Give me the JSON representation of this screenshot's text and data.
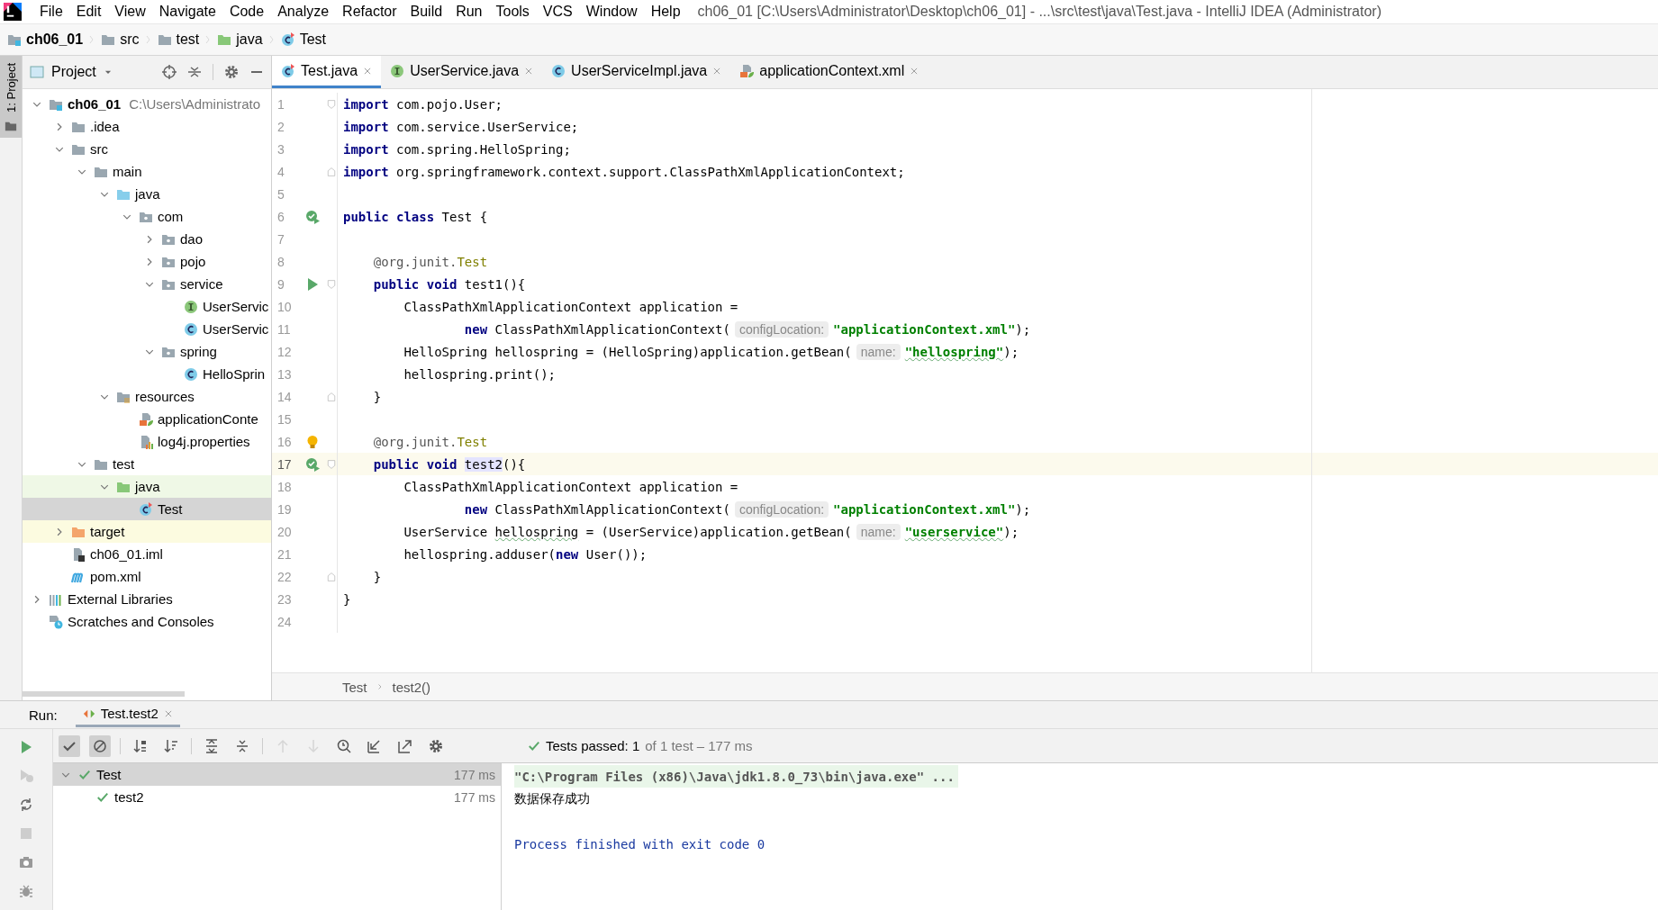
{
  "window": {
    "title": "ch06_01 [C:\\Users\\Administrator\\Desktop\\ch06_01] - ...\\src\\test\\java\\Test.java - IntelliJ IDEA (Administrator)"
  },
  "menu": [
    "File",
    "Edit",
    "View",
    "Navigate",
    "Code",
    "Analyze",
    "Refactor",
    "Build",
    "Run",
    "Tools",
    "VCS",
    "Window",
    "Help"
  ],
  "navigation_bar": [
    {
      "label": "ch06_01",
      "kind": "module"
    },
    {
      "label": "src",
      "kind": "folder"
    },
    {
      "label": "test",
      "kind": "folder"
    },
    {
      "label": "java",
      "kind": "test-root"
    },
    {
      "label": "Test",
      "kind": "test-class"
    }
  ],
  "left_tool_strip": {
    "label": "1: Project"
  },
  "project_panel": {
    "title": "Project",
    "tree": [
      {
        "label": "ch06_01",
        "path": "C:\\Users\\Administrato",
        "kind": "module",
        "expanded": true,
        "selected": false,
        "children": [
          {
            "label": ".idea",
            "kind": "folder",
            "expanded": false,
            "selected": false
          },
          {
            "label": "src",
            "kind": "folder",
            "expanded": true,
            "selected": false,
            "children": [
              {
                "label": "main",
                "kind": "folder",
                "expanded": true,
                "selected": false,
                "children": [
                  {
                    "label": "java",
                    "kind": "source-root",
                    "expanded": true,
                    "selected": false,
                    "children": [
                      {
                        "label": "com",
                        "kind": "package",
                        "expanded": true,
                        "selected": false,
                        "children": [
                          {
                            "label": "dao",
                            "kind": "package",
                            "expanded": false,
                            "selected": false
                          },
                          {
                            "label": "pojo",
                            "kind": "package",
                            "expanded": false,
                            "selected": false
                          },
                          {
                            "label": "service",
                            "kind": "package",
                            "expanded": true,
                            "selected": false,
                            "children": [
                              {
                                "label": "UserServic",
                                "kind": "interface",
                                "selected": false
                              },
                              {
                                "label": "UserServic",
                                "kind": "class",
                                "selected": false
                              }
                            ]
                          },
                          {
                            "label": "spring",
                            "kind": "package",
                            "expanded": true,
                            "selected": false,
                            "children": [
                              {
                                "label": "HelloSprin",
                                "kind": "class",
                                "selected": false
                              }
                            ]
                          }
                        ]
                      }
                    ]
                  },
                  {
                    "label": "resources",
                    "kind": "resources-root",
                    "expanded": true,
                    "selected": false,
                    "children": [
                      {
                        "label": "applicationConte",
                        "kind": "xml",
                        "selected": false
                      },
                      {
                        "label": "log4j.properties",
                        "kind": "properties",
                        "selected": false
                      }
                    ]
                  }
                ]
              },
              {
                "label": "test",
                "kind": "folder",
                "expanded": true,
                "selected": false,
                "children": [
                  {
                    "label": "java",
                    "kind": "test-root",
                    "expanded": true,
                    "selected": false,
                    "children": [
                      {
                        "label": "Test",
                        "kind": "test-class",
                        "selected": true
                      }
                    ]
                  }
                ]
              }
            ]
          },
          {
            "label": "target",
            "kind": "excluded",
            "expanded": false,
            "selected": false
          },
          {
            "label": "ch06_01.iml",
            "kind": "iml",
            "selected": false
          },
          {
            "label": "pom.xml",
            "kind": "maven",
            "selected": false
          }
        ]
      },
      {
        "label": "External Libraries",
        "kind": "libraries",
        "expanded": false,
        "selected": false
      },
      {
        "label": "Scratches and Consoles",
        "kind": "scratches",
        "selected": false
      }
    ]
  },
  "editor": {
    "tabs": [
      {
        "label": "Test.java",
        "kind": "test-class",
        "selected": true
      },
      {
        "label": "UserService.java",
        "kind": "interface",
        "selected": false
      },
      {
        "label": "UserServiceImpl.java",
        "kind": "class",
        "selected": false
      },
      {
        "label": "applicationContext.xml",
        "kind": "xml",
        "selected": false
      }
    ],
    "lines": [
      {
        "number": "1",
        "fold": {
          "kind": "start"
        },
        "current": false,
        "tokens": [
          {
            "kind": "keyword",
            "text": "import"
          },
          {
            "kind": "plain",
            "text": " com.pojo.User;"
          }
        ]
      },
      {
        "number": "2",
        "current": false,
        "tokens": [
          {
            "kind": "keyword",
            "text": "import"
          },
          {
            "kind": "plain",
            "text": " com.service.UserService;"
          }
        ]
      },
      {
        "number": "3",
        "current": false,
        "tokens": [
          {
            "kind": "keyword",
            "text": "import"
          },
          {
            "kind": "plain",
            "text": " com.spring.HelloSpring;"
          }
        ]
      },
      {
        "number": "4",
        "fold": {
          "kind": "end"
        },
        "current": false,
        "tokens": [
          {
            "kind": "keyword",
            "text": "import"
          },
          {
            "kind": "plain",
            "text": " org.springframework.context.support.ClassPathXmlApplicationContext;"
          }
        ]
      },
      {
        "number": "5",
        "current": false
      },
      {
        "number": "6",
        "marker": {
          "kind": "rerun"
        },
        "current": false,
        "tokens": [
          {
            "kind": "keyword",
            "text": "public class"
          },
          {
            "kind": "plain",
            "text": " Test {"
          }
        ]
      },
      {
        "number": "7",
        "current": false
      },
      {
        "number": "8",
        "current": false,
        "tokens": [
          {
            "kind": "annotation",
            "text": "    @org.junit."
          },
          {
            "kind": "annotation-name",
            "text": "Test"
          }
        ]
      },
      {
        "number": "9",
        "marker": {
          "kind": "run"
        },
        "fold": {
          "kind": "start"
        },
        "current": false,
        "tokens": [
          {
            "kind": "keyword",
            "text": "    public void"
          },
          {
            "kind": "plain",
            "text": " test1(){"
          }
        ]
      },
      {
        "number": "10",
        "current": false,
        "tokens": [
          {
            "kind": "plain",
            "text": "        ClassPathXmlApplicationContext application ="
          }
        ]
      },
      {
        "number": "11",
        "current": false,
        "tokens": [
          {
            "kind": "keyword",
            "text": "                new"
          },
          {
            "kind": "plain",
            "text": " ClassPathXmlApplicationContext("
          },
          {
            "kind": "hint",
            "text": "configLocation:"
          },
          {
            "kind": "string",
            "text": "\"applicationContext.xml\""
          },
          {
            "kind": "plain",
            "text": ");"
          }
        ]
      },
      {
        "number": "12",
        "current": false,
        "tokens": [
          {
            "kind": "plain",
            "text": "        HelloSpring hellospring = (HelloSpring)application.getBean("
          },
          {
            "kind": "hint",
            "text": "name:"
          },
          {
            "kind": "typo-string",
            "text": "\"hellospring\""
          },
          {
            "kind": "plain",
            "text": ");"
          }
        ]
      },
      {
        "number": "13",
        "current": false,
        "tokens": [
          {
            "kind": "plain",
            "text": "        hellospring.print();"
          }
        ]
      },
      {
        "number": "14",
        "fold": {
          "kind": "end"
        },
        "current": false,
        "tokens": [
          {
            "kind": "plain",
            "text": "    }"
          }
        ]
      },
      {
        "number": "15",
        "current": false
      },
      {
        "number": "16",
        "marker": {
          "kind": "bulb"
        },
        "current": false,
        "tokens": [
          {
            "kind": "annotation",
            "text": "    @org.junit."
          },
          {
            "kind": "annotation-name",
            "text": "Test"
          }
        ]
      },
      {
        "number": "17",
        "marker": {
          "kind": "rerun"
        },
        "fold": {
          "kind": "start"
        },
        "current": true,
        "tokens": [
          {
            "kind": "keyword",
            "text": "    public void "
          },
          {
            "kind": "usage",
            "text": "test2"
          },
          {
            "kind": "plain",
            "text": "(){"
          }
        ]
      },
      {
        "number": "18",
        "current": false,
        "tokens": [
          {
            "kind": "plain",
            "text": "        ClassPathXmlApplicationContext application ="
          }
        ]
      },
      {
        "number": "19",
        "current": false,
        "tokens": [
          {
            "kind": "keyword",
            "text": "                new"
          },
          {
            "kind": "plain",
            "text": " ClassPathXmlApplicationContext("
          },
          {
            "kind": "hint",
            "text": "configLocation:"
          },
          {
            "kind": "string",
            "text": "\"applicationContext.xml\""
          },
          {
            "kind": "plain",
            "text": ");"
          }
        ]
      },
      {
        "number": "20",
        "current": false,
        "tokens": [
          {
            "kind": "plain",
            "text": "        UserService "
          },
          {
            "kind": "typo",
            "text": "hellospring"
          },
          {
            "kind": "plain",
            "text": " = (UserService)application.getBean("
          },
          {
            "kind": "hint",
            "text": "name:"
          },
          {
            "kind": "typo-string",
            "text": "\"userservice\""
          },
          {
            "kind": "plain",
            "text": ");"
          }
        ]
      },
      {
        "number": "21",
        "current": false,
        "tokens": [
          {
            "kind": "plain",
            "text": "        hellospring.adduser("
          },
          {
            "kind": "keyword",
            "text": "new"
          },
          {
            "kind": "plain",
            "text": " User());"
          }
        ]
      },
      {
        "number": "22",
        "fold": {
          "kind": "end"
        },
        "current": false,
        "tokens": [
          {
            "kind": "plain",
            "text": "    }"
          }
        ]
      },
      {
        "number": "23",
        "current": false,
        "tokens": [
          {
            "kind": "plain",
            "text": "}"
          }
        ]
      },
      {
        "number": "24",
        "current": false
      }
    ],
    "breadcrumbs": [
      "Test",
      "test2()"
    ]
  },
  "run_panel": {
    "label": "Run:",
    "tab": {
      "label": "Test.test2",
      "selected": true
    },
    "toolbar": [
      {
        "kind": "check",
        "pressed": true,
        "disabled": false
      },
      {
        "kind": "ignored",
        "pressed": true,
        "disabled": false
      },
      {
        "kind": "sort-alpha",
        "pressed": false,
        "disabled": false
      },
      {
        "kind": "sort-duration",
        "pressed": false,
        "disabled": false
      },
      {
        "kind": "expand-all",
        "pressed": false,
        "disabled": false
      },
      {
        "kind": "collapse-all",
        "pressed": false,
        "disabled": false
      },
      {
        "kind": "up",
        "pressed": false,
        "disabled": true
      },
      {
        "kind": "down",
        "pressed": false,
        "disabled": true
      },
      {
        "kind": "history",
        "pressed": false,
        "disabled": false
      },
      {
        "kind": "import",
        "pressed": false,
        "disabled": false
      },
      {
        "kind": "export",
        "pressed": false,
        "disabled": false
      },
      {
        "kind": "settings",
        "pressed": false,
        "disabled": false
      }
    ],
    "side_toolbar": [
      {
        "kind": "rerun",
        "disabled": false
      },
      {
        "kind": "rerun-failed",
        "disabled": true
      },
      {
        "kind": "auto-test",
        "disabled": false
      },
      {
        "kind": "stop",
        "disabled": true
      },
      {
        "kind": "camera",
        "disabled": false
      },
      {
        "kind": "bug",
        "disabled": false
      }
    ],
    "status": {
      "text": "Tests passed: 1",
      "detail": "of 1 test – 177 ms"
    },
    "tests": [
      {
        "label": "Test",
        "time": "177 ms",
        "expanded": true,
        "selected": true,
        "children": [
          {
            "label": "test2",
            "time": "177 ms",
            "selected": false
          }
        ]
      }
    ],
    "console": [
      {
        "kind": "command",
        "text": "\"C:\\Program Files (x86)\\Java\\jdk1.8.0_73\\bin\\java.exe\" ..."
      },
      {
        "kind": "output",
        "text": "数据保存成功"
      },
      {
        "kind": "exit",
        "text": "Process finished with exit code 0"
      }
    ]
  }
}
